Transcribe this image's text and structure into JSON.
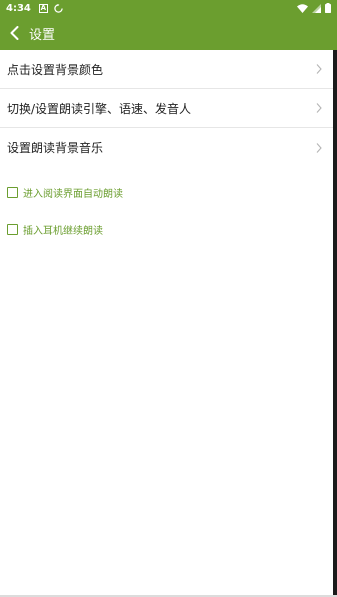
{
  "status_bar": {
    "time": "4:34",
    "notification_icon": "A",
    "icons": [
      "notification-a-icon",
      "sync-icon",
      "wifi-icon",
      "signal-icon",
      "battery-icon"
    ]
  },
  "app_bar": {
    "title": "设置",
    "back_icon": "chevron-left-icon",
    "color": "#6b9e2f"
  },
  "settings": {
    "items": [
      {
        "label": "点击设置背景颜色"
      },
      {
        "label": "切换/设置朗读引擎、语速、发音人"
      },
      {
        "label": "设置朗读背景音乐"
      }
    ],
    "checkboxes": [
      {
        "label": "进入阅读界面自动朗读",
        "checked": false
      },
      {
        "label": "插入耳机继续朗读",
        "checked": false
      }
    ]
  }
}
